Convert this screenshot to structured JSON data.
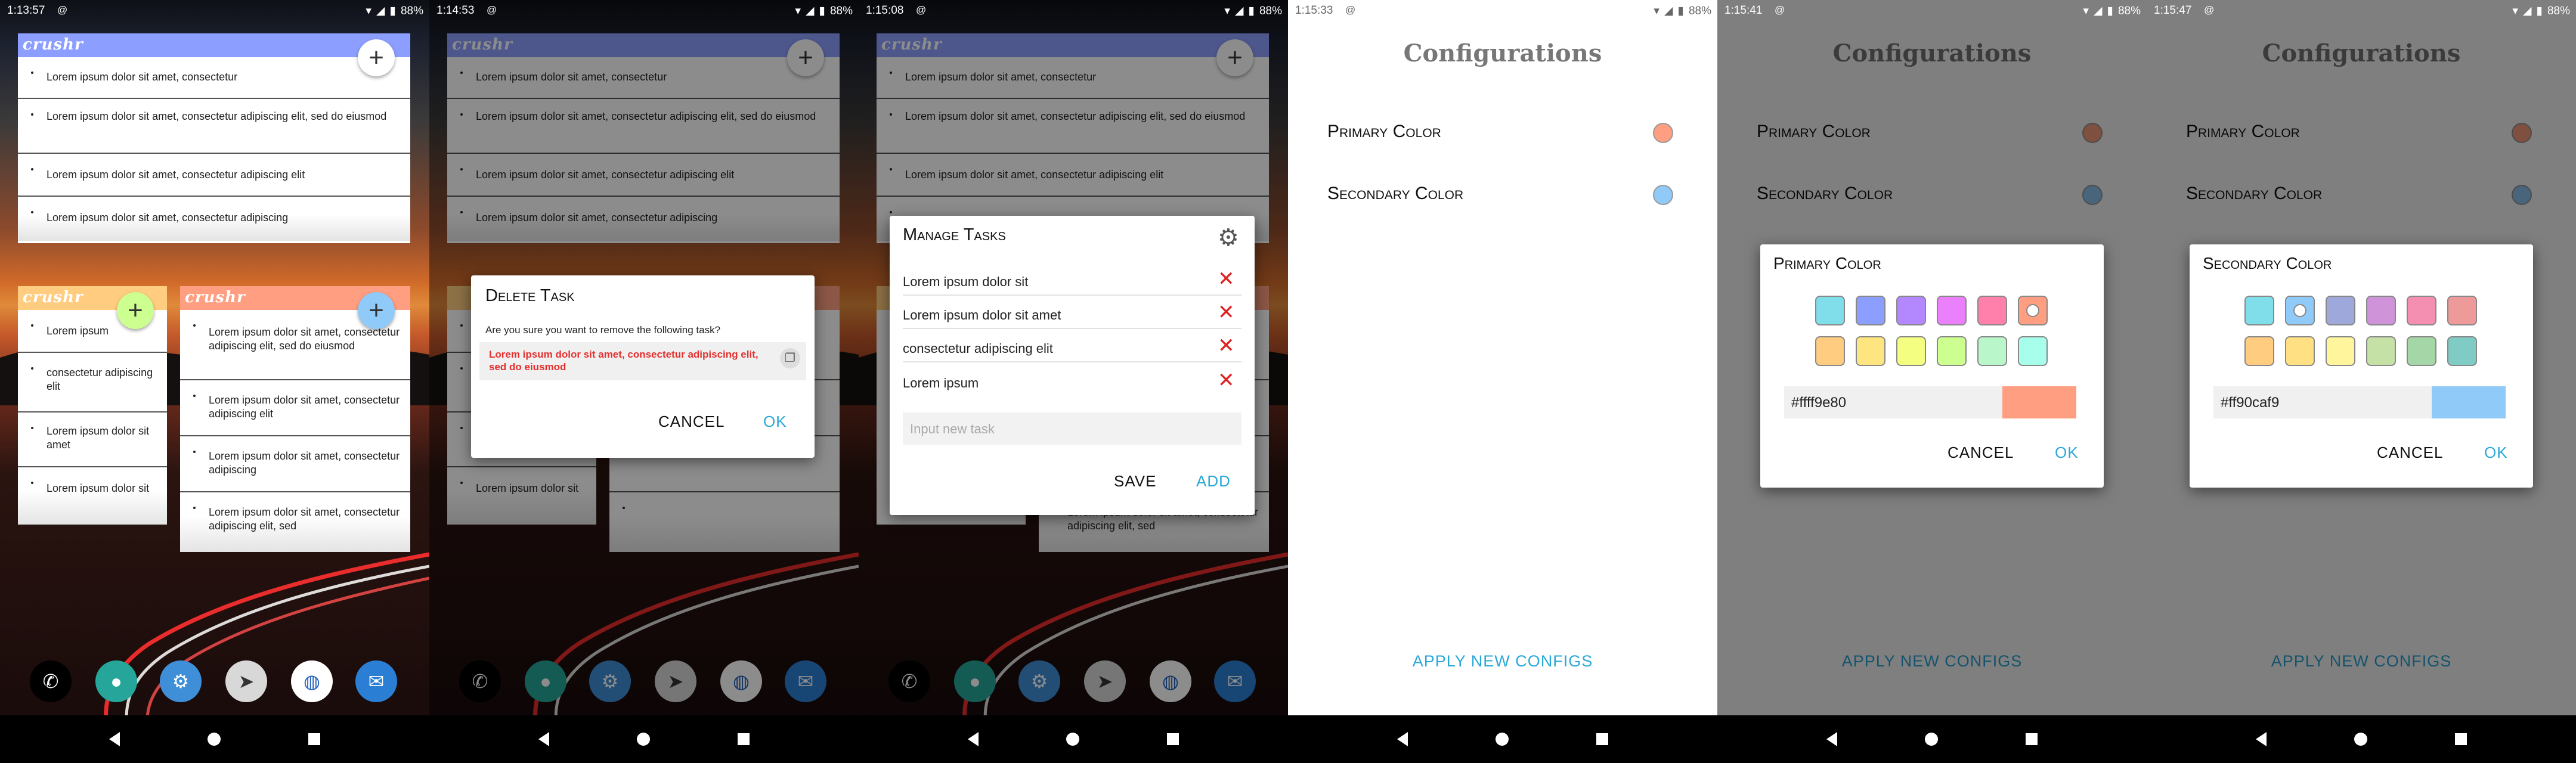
{
  "status": {
    "icon": "@",
    "battery": "88%",
    "times": [
      "1:13:57",
      "1:14:53",
      "1:15:08",
      "1:15:33",
      "1:15:41",
      "1:15:47"
    ]
  },
  "widget": {
    "brand": "crushr",
    "add": "+",
    "big_items": [
      "Lorem ipsum dolor sit amet, consectetur",
      "Lorem ipsum dolor sit amet, consectetur adipiscing elit, sed do eiusmod",
      "Lorem ipsum dolor sit amet, consectetur adipiscing elit",
      "Lorem ipsum dolor sit amet, consectetur adipiscing"
    ],
    "small_items": [
      "Lorem ipsum",
      "consectetur adipiscing elit",
      "Lorem ipsum dolor sit amet",
      "Lorem ipsum dolor sit"
    ],
    "mid_items": [
      "Lorem ipsum dolor sit amet, consectetur adipiscing elit, sed do eiusmod",
      "Lorem ipsum dolor sit amet, consectetur adipiscing elit",
      "Lorem ipsum dolor sit amet, consectetur adipiscing",
      "Lorem ipsum dolor sit amet, consectetur adipiscing elit, sed"
    ]
  },
  "delete_dialog": {
    "title": "Delete Task",
    "question": "Are you sure you want to remove the following task?",
    "task": "Lorem ipsum dolor sit amet, consectetur adipiscing elit, sed do eiusmod",
    "cancel": "CANCEL",
    "ok": "OK"
  },
  "manage_dialog": {
    "title": "Manage Tasks",
    "tasks": [
      "Lorem ipsum dolor sit",
      "Lorem ipsum dolor sit amet",
      "consectetur adipiscing elit",
      "Lorem ipsum"
    ],
    "remove_glyph": "✕",
    "placeholder": "Input new task",
    "save": "SAVE",
    "add": "ADD"
  },
  "config": {
    "title": "Configurations",
    "primary_label": "Primary Color",
    "secondary_label": "Secondary Color",
    "apply": "APPLY NEW CONFIGS",
    "primary_color": "#ff9e80",
    "secondary_color": "#90caf9"
  },
  "picker_primary": {
    "title": "Primary Color",
    "hex": "#ffff9e80",
    "cancel": "CANCEL",
    "ok": "OK"
  },
  "picker_secondary": {
    "title": "Secondary Color",
    "hex": "#ff90caf9",
    "cancel": "CANCEL",
    "ok": "OK"
  },
  "palette": {
    "row1": [
      "#80deea",
      "#8c9eff",
      "#b388ff",
      "#ea80fc",
      "#ff80ab",
      "#ff9e80"
    ],
    "row2": [
      "#ffcc80",
      "#ffe57f",
      "#f4ff81",
      "#ccff90",
      "#b9f6ca",
      "#a7ffeb"
    ],
    "row1b": [
      "#80deea",
      "#90caf9",
      "#9fa8da",
      "#ce93d8",
      "#f48fb1",
      "#ef9a9a"
    ],
    "row2b": [
      "#ffcc80",
      "#ffe082",
      "#fff59d",
      "#c5e1a5",
      "#a5d6a7",
      "#80cbc4"
    ]
  },
  "dock_icons": [
    "phone-icon",
    "chat-icon",
    "settings-icon",
    "telegram-icon",
    "browser-icon",
    "mail-icon"
  ]
}
